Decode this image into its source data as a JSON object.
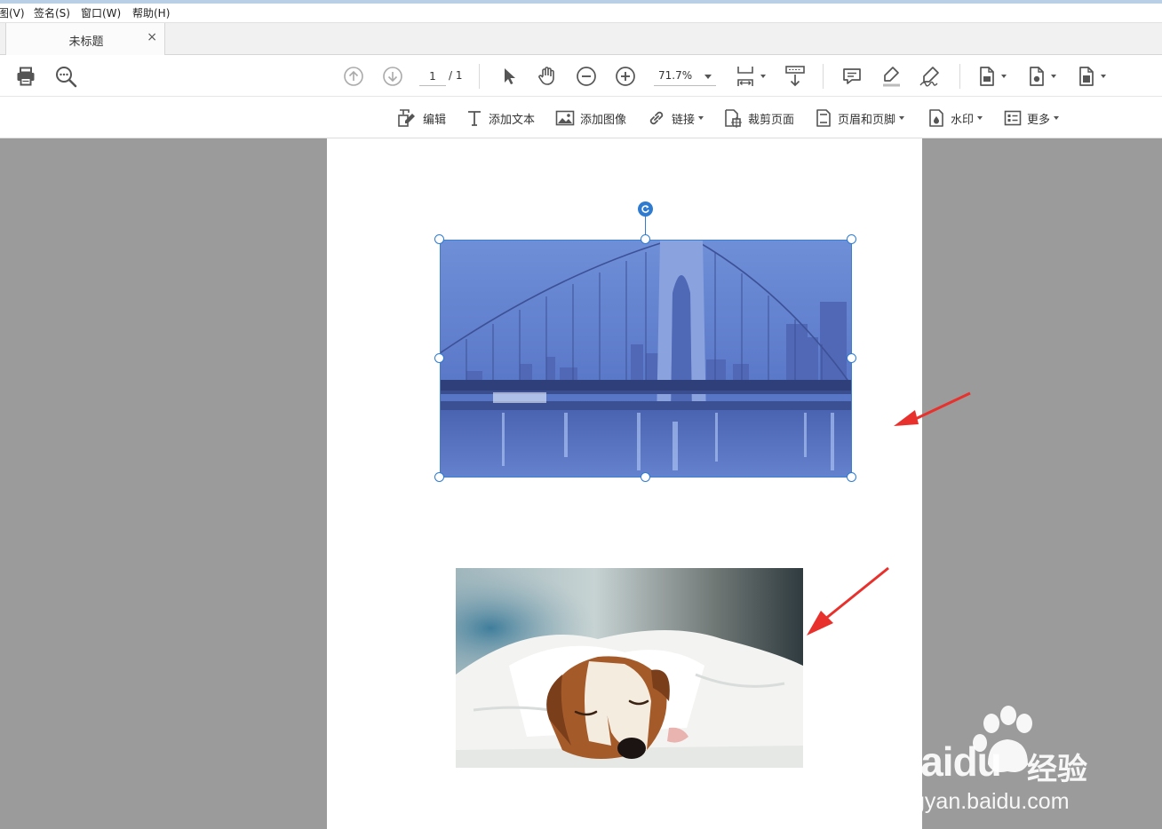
{
  "menu": {
    "items": [
      {
        "label": "图(V)"
      },
      {
        "label": "签名(S)"
      },
      {
        "label": "窗口(W)"
      },
      {
        "label": "帮助(H)"
      }
    ]
  },
  "tab": {
    "title": "未标题",
    "close": "×"
  },
  "toolbar": {
    "print_icon": "printer-icon",
    "search_icon": "search-zoom-icon",
    "page_current": "1",
    "page_total": "/ 1",
    "zoom": "71.7%",
    "icons": [
      "printer-icon",
      "search-zoom-icon",
      "arrow-up-circle-icon",
      "arrow-down-circle-icon",
      "pointer-icon",
      "hand-icon",
      "zoom-out-icon",
      "zoom-in-icon",
      "fit-page-icon",
      "scroll-down-icon",
      "comment-icon",
      "highlight-icon",
      "sign-icon",
      "document-icon",
      "document-settings-icon",
      "document-export-icon"
    ]
  },
  "edit_toolbar": {
    "edit": "编辑",
    "add_text": "添加文本",
    "add_image": "添加图像",
    "link": "链接",
    "crop": "裁剪页面",
    "header_footer": "页眉和页脚",
    "watermark": "水印",
    "more": "更多"
  },
  "watermark": {
    "brand": "Baidu",
    "brand_cn": "经验",
    "url": "jingyan.baidu.com"
  },
  "colors": {
    "accent": "#2f7bd0",
    "arrow": "#e8302c",
    "workspace": "#9b9b9b"
  }
}
